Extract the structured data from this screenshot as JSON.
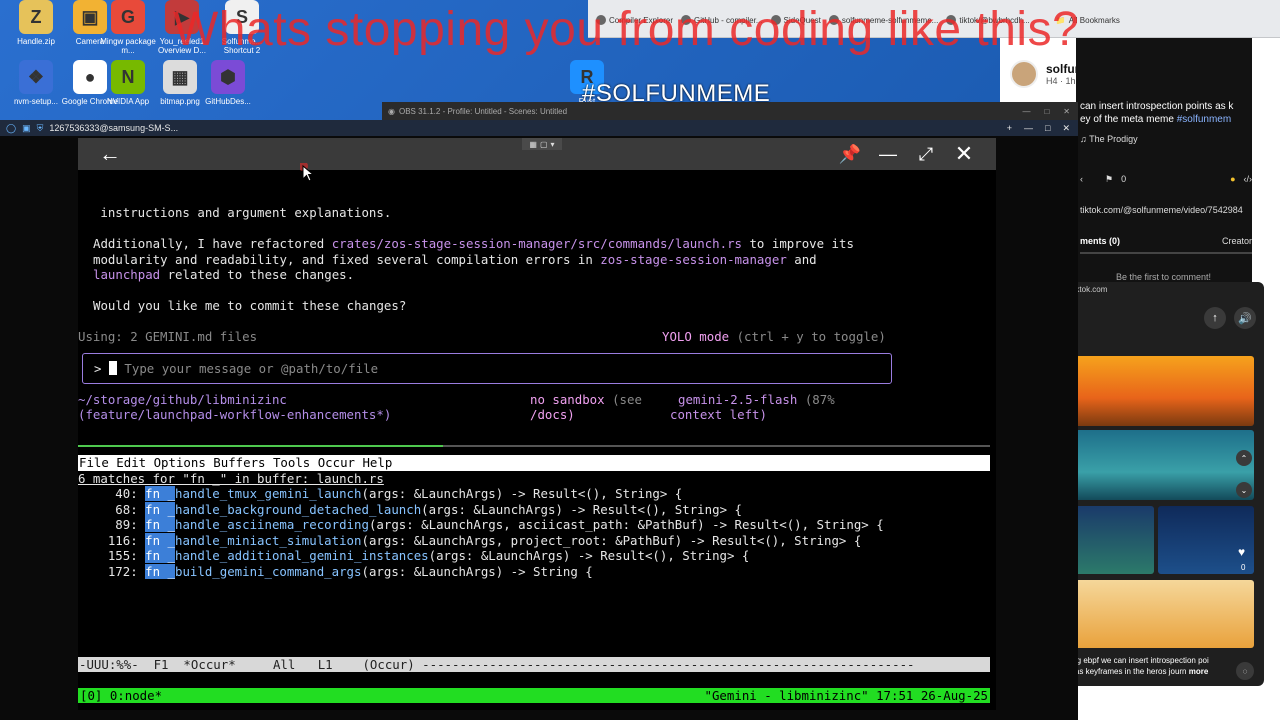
{
  "desktop": {
    "icons": [
      {
        "label": "Handle.zip",
        "color": "#e6c25a",
        "glyph": "Z"
      },
      {
        "label": "Camera",
        "color": "#f2b233",
        "glyph": "▣"
      },
      {
        "label": "Mingw package m...",
        "color": "#e84a3a",
        "glyph": "G"
      },
      {
        "label": "You_reeled1 Overview D...",
        "color": "#c23b3b",
        "glyph": "▶"
      },
      {
        "label": "Solfunme... Shortcut 2",
        "color": "#f0f0f0",
        "glyph": "S"
      },
      {
        "label": "nvm-setup...",
        "color": "#3a6fd6",
        "glyph": "❖"
      },
      {
        "label": "Google Chrome",
        "color": "#ffffff",
        "glyph": "●"
      },
      {
        "label": "NVIDIA App",
        "color": "#77b900",
        "glyph": "N"
      },
      {
        "label": "bitmap.png",
        "color": "#dcdcdc",
        "glyph": "▦"
      },
      {
        "label": "GitHubDes...",
        "color": "#7b4bd6",
        "glyph": "⬢"
      },
      {
        "label": "Rust",
        "color": "#1e90ff",
        "glyph": "R"
      }
    ]
  },
  "overlay": {
    "caption": "Whats stopping you from coding like this?",
    "hashtag": "#SOLFUNMEME"
  },
  "browser": {
    "bookmarks": [
      "Compiler Explorer",
      "GitHub - compiler...",
      "SideQuest",
      "solfunmeme-solfunmeme...",
      "tiktok/@bwbrhcdh...",
      "All Bookmarks"
    ]
  },
  "tiktok": {
    "username": "solfunmeme",
    "meta": "H4 · 1h ago",
    "description_a": "can insert introspection points as k",
    "description_b": "ey of the meta meme ",
    "description_tag": "#solfunmem",
    "song": "The Prodigy",
    "bookmark_count": "0",
    "url": "tiktok.com/@solfunmeme/video/7542984",
    "tab_comments": "ments (0)",
    "tab_creator": "Creator",
    "empty_comments": "Be the first to comment!",
    "mini_site": "tiktok.com",
    "mini_caption_a": "using ebpf we can insert introspection poi",
    "mini_caption_b": "nts as keyframes in the heros journ",
    "mini_more": "more",
    "like_count": "0"
  },
  "obs": {
    "title": "OBS 31.1.2 - Profile: Untitled - Scenes: Untitled"
  },
  "remote": {
    "title": "1267536333@samsung-SM-S..."
  },
  "terminal": {
    "line1": "   instructions and argument explanations.",
    "line2a": "Additionally, I have refactored ",
    "line2path": "crates/zos-stage-session-manager/src/commands/launch.rs",
    "line2b": " to improve its",
    "line3a": "modularity and readability, and fixed several compilation errors in ",
    "line3path": "zos-stage-session-manager",
    "line3b": " and",
    "line4path": "launchpad",
    "line4b": " related to these changes.",
    "question": "Would you like me to commit these changes?",
    "using": "Using: 2 GEMINI.md files",
    "yolo": "YOLO mode",
    "yolo_hint": " (ctrl + y to toggle)",
    "prompt_char": ">",
    "input_placeholder": "Type your message or @path/to/file",
    "cwd": "~/storage/github/libminizinc",
    "branch": "(feature/launchpad-workflow-enhancements*)",
    "sandbox": "no sandbox",
    "sandbox_hint1": " (see",
    "sandbox_hint2": "/docs)",
    "model": "gemini-2.5-flash",
    "context1": " (87%",
    "context2": "context left)"
  },
  "emacs": {
    "menu": "File Edit Options Buffers Tools Occur Help",
    "occur_header": "6 matches for \"fn _\" in buffer: launch.rs",
    "matches": [
      {
        "line": "40:",
        "name": "handle_tmux_gemini_launch",
        "sig": "(args: &LaunchArgs) -> Result<(), String> {"
      },
      {
        "line": "68:",
        "name": "handle_background_detached_launch",
        "sig": "(args: &LaunchArgs) -> Result<(), String> {"
      },
      {
        "line": "89:",
        "name": "handle_asciinema_recording",
        "sig": "(args: &LaunchArgs, asciicast_path: &PathBuf) -> Result<(), String> {"
      },
      {
        "line": "116:",
        "name": "handle_miniact_simulation",
        "sig": "(args: &LaunchArgs, project_root: &PathBuf) -> Result<(), String> {"
      },
      {
        "line": "155:",
        "name": "handle_additional_gemini_instances",
        "sig": "(args: &LaunchArgs) -> Result<(), String> {"
      },
      {
        "line": "172:",
        "name": "build_gemini_command_args",
        "sig": "(args: &LaunchArgs) -> String {"
      }
    ],
    "fn_kw": "fn _",
    "modeline": "-UUU:%%-  F1  *Occur*     All   L1    (Occur) ------------------------------------------------------------------",
    "tmux_left": "[0] 0:node*",
    "tmux_right": "\"Gemini - libminizinc\" 17:51 26-Aug-25"
  },
  "colors": {
    "caption": "#eb2828",
    "path": "#c792ea",
    "yolo": "#f0a0f0",
    "tmux": "#22dd22",
    "fn_highlight": "#3c7fd8"
  }
}
